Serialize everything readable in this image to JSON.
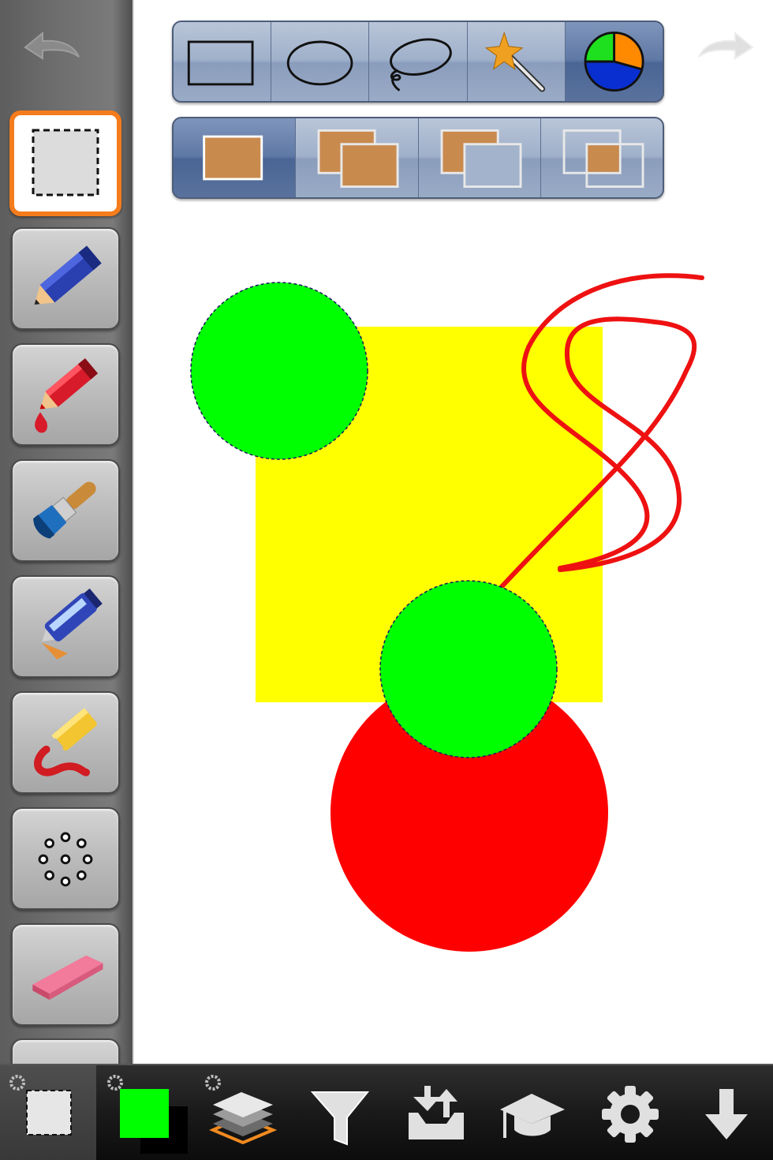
{
  "app": {
    "accent_color": "#f47c1c",
    "toolbar_color": "#9fb0ca"
  },
  "history": {
    "undo_icon": "undo-arrow-icon",
    "redo_icon": "redo-arrow-icon"
  },
  "tools": [
    {
      "name": "selection",
      "icon": "dashed-selection-icon",
      "selected": true
    },
    {
      "name": "pencil",
      "icon": "blue-pencil-icon",
      "selected": false
    },
    {
      "name": "ink-pen",
      "icon": "red-pen-drop-icon",
      "selected": false
    },
    {
      "name": "paint-brush",
      "icon": "paint-brush-icon",
      "selected": false
    },
    {
      "name": "airbrush",
      "icon": "airbrush-icon",
      "selected": false
    },
    {
      "name": "paint-tube",
      "icon": "paint-tube-icon",
      "selected": false
    },
    {
      "name": "spray-pattern",
      "icon": "dot-circle-icon",
      "selected": false
    },
    {
      "name": "eraser",
      "icon": "eraser-icon",
      "selected": false
    }
  ],
  "selection_shapes": [
    {
      "name": "rectangle",
      "icon": "rectangle-select-icon",
      "active": false
    },
    {
      "name": "ellipse",
      "icon": "ellipse-select-icon",
      "active": false
    },
    {
      "name": "lasso",
      "icon": "lasso-icon",
      "active": false
    },
    {
      "name": "magic-wand",
      "icon": "magic-wand-icon",
      "active": false
    },
    {
      "name": "color-select",
      "icon": "color-pie-icon",
      "active": true
    }
  ],
  "selection_modes": [
    {
      "name": "new",
      "icon": "mode-new-icon",
      "active": true
    },
    {
      "name": "add",
      "icon": "mode-add-icon",
      "active": false
    },
    {
      "name": "subtract",
      "icon": "mode-subtract-icon",
      "active": false
    },
    {
      "name": "intersect",
      "icon": "mode-intersect-icon",
      "active": false
    }
  ],
  "canvas": {
    "colors": {
      "yellow": "#ffff00",
      "green": "#00ff00",
      "red": "#ff0000",
      "stroke": "#ee1111"
    }
  },
  "bottom_bar": {
    "current_color": "#00ff00",
    "items": [
      {
        "name": "selection-settings",
        "icon": "selection-square-icon"
      },
      {
        "name": "color",
        "icon": "color-swatch-icon"
      },
      {
        "name": "layers",
        "icon": "layers-icon"
      },
      {
        "name": "filters",
        "icon": "filter-funnel-icon"
      },
      {
        "name": "import-export",
        "icon": "import-export-icon"
      },
      {
        "name": "tutorials",
        "icon": "graduation-cap-icon"
      },
      {
        "name": "settings",
        "icon": "gear-icon"
      },
      {
        "name": "save",
        "icon": "download-arrow-icon"
      }
    ]
  }
}
